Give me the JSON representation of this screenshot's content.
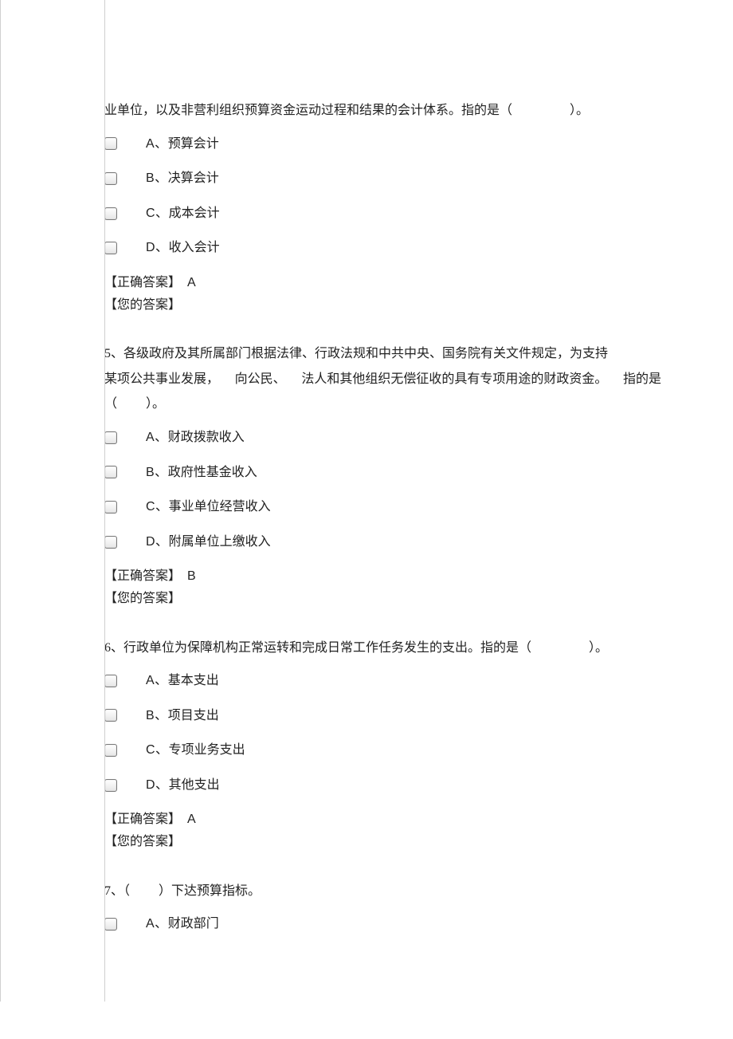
{
  "q4": {
    "stem_part1": "业单位，以及非营利组织预算资金运动过程和结果的会计体系。指的是（",
    "stem_blank": "　　　　",
    "stem_part2": "）。",
    "options": {
      "A": {
        "letter": "A、",
        "text": "预算会计"
      },
      "B": {
        "letter": "B、",
        "text": "决算会计"
      },
      "C": {
        "letter": "C、",
        "text": "成本会计"
      },
      "D": {
        "letter": "D、",
        "text": "收入会计"
      }
    },
    "correct_label": "【正确答案】",
    "correct_value": "A",
    "your_label": "【您的答案】"
  },
  "q5": {
    "stem_num": "5、",
    "stem_line1": "各级政府及其所属部门根据法律、行政法规和中共中央、国务院有关文件规定，为支持",
    "stem_line2a": "某项公共事业发展，",
    "stem_line2b": "向公民、",
    "stem_line2c": "法人和其他组织无偿征收的具有专项用途的财政资金。",
    "stem_line2d": "指的是",
    "stem_line3a": "（",
    "stem_line3_blank": "　　",
    "stem_line3b": "）。",
    "options": {
      "A": {
        "letter": "A、",
        "text": "财政拨款收入"
      },
      "B": {
        "letter": "B、",
        "text": "政府性基金收入"
      },
      "C": {
        "letter": "C、",
        "text": "事业单位经营收入"
      },
      "D": {
        "letter": "D、",
        "text": "附属单位上缴收入"
      }
    },
    "correct_label": "【正确答案】",
    "correct_value": "B",
    "your_label": "【您的答案】"
  },
  "q6": {
    "stem_num": "6、",
    "stem_part1": "行政单位为保障机构正常运转和完成日常工作任务发生的支出。指的是（",
    "stem_blank": "　　　　",
    "stem_part2": "）。",
    "options": {
      "A": {
        "letter": "A、",
        "text": "基本支出"
      },
      "B": {
        "letter": "B、",
        "text": "项目支出"
      },
      "C": {
        "letter": "C、",
        "text": "专项业务支出"
      },
      "D": {
        "letter": "D、",
        "text": "其他支出"
      }
    },
    "correct_label": "【正确答案】",
    "correct_value": "A",
    "your_label": "【您的答案】"
  },
  "q7": {
    "stem_num": "7、",
    "stem_part1": "（",
    "stem_blank": "　　",
    "stem_part2": "）下达预算指标。",
    "options": {
      "A": {
        "letter": "A、",
        "text": "财政部门"
      }
    }
  }
}
